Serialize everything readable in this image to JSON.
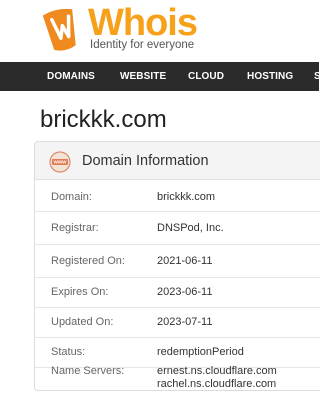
{
  "logo": {
    "wordmark": "Whois",
    "tagline": "Identity for everyone",
    "icon": "whois-logo-icon",
    "brand_color": "#f7a11a",
    "icon_color": "#e8861a"
  },
  "nav": {
    "items": [
      {
        "label": "DOMAINS"
      },
      {
        "label": "WEBSITE"
      },
      {
        "label": "CLOUD"
      },
      {
        "label": "HOSTING"
      },
      {
        "label": "S"
      }
    ],
    "background": "#2b2b2b"
  },
  "domain": {
    "name": "brickkk.com"
  },
  "card": {
    "title": "Domain Information",
    "icon": "www-icon",
    "rows": [
      {
        "label": "Domain:",
        "value": "brickkk.com"
      },
      {
        "label": "Registrar:",
        "value": "DNSPod, Inc."
      },
      {
        "label": "Registered On:",
        "value": "2021-06-11"
      },
      {
        "label": "Expires On:",
        "value": "2023-06-11"
      },
      {
        "label": "Updated On:",
        "value": "2023-07-11"
      },
      {
        "label": "Status:",
        "value": "redemptionPeriod"
      },
      {
        "label": "Name Servers:",
        "values": [
          "ernest.ns.cloudflare.com",
          "rachel.ns.cloudflare.com"
        ]
      }
    ]
  }
}
